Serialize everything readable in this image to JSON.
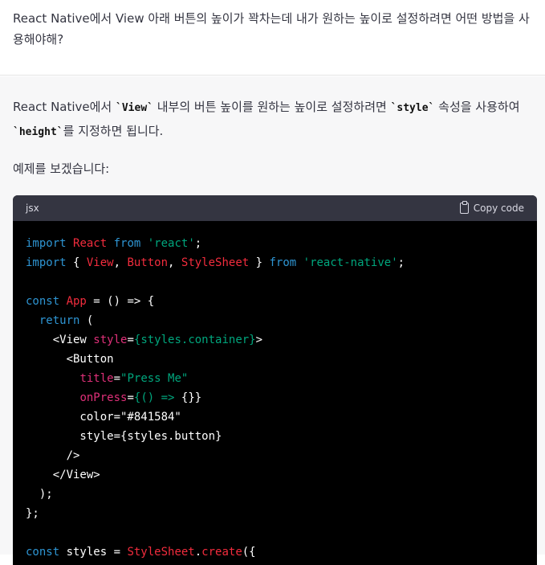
{
  "user_message": {
    "text": "React Native에서 View 아래 버튼의 높이가 꽉차는데 내가 원하는 높이로 설정하려면 어떤 방법을 사용해야해?"
  },
  "assistant_message": {
    "p1_a": "React Native에서 ",
    "p1_code1": "`View`",
    "p1_b": " 내부의 버튼 높이를 원하는 높이로 설정하려면 ",
    "p1_code2": "`style`",
    "p1_c": " 속성을 사용하여 ",
    "p1_code3": "`height`",
    "p1_d": "를 지정하면 됩니다.",
    "p2": "예제를 보겠습니다:"
  },
  "code_block": {
    "language": "jsx",
    "copy_label": "Copy code",
    "lines": [
      [
        [
          "kw",
          "import "
        ],
        [
          "cls",
          "React "
        ],
        [
          "kw",
          "from "
        ],
        [
          "str",
          "'react'"
        ],
        [
          "pl",
          ";"
        ]
      ],
      [
        [
          "kw",
          "import "
        ],
        [
          "pl",
          "{ "
        ],
        [
          "cls",
          "View"
        ],
        [
          "pl",
          ", "
        ],
        [
          "cls",
          "Button"
        ],
        [
          "pl",
          ", "
        ],
        [
          "cls",
          "StyleSheet"
        ],
        [
          "pl",
          " } "
        ],
        [
          "kw",
          "from "
        ],
        [
          "str",
          "'react-native'"
        ],
        [
          "pl",
          ";"
        ]
      ],
      [],
      [
        [
          "kw",
          "const "
        ],
        [
          "cls",
          "App"
        ],
        [
          "pl",
          " = () => {"
        ]
      ],
      [
        [
          "pl",
          "  "
        ],
        [
          "kw",
          "return"
        ],
        [
          "pl",
          " ("
        ]
      ],
      [
        [
          "pl",
          "    <View "
        ],
        [
          "attr",
          "style"
        ],
        [
          "pl",
          "="
        ],
        [
          "str",
          "{styles.container}"
        ],
        [
          "pl",
          ">"
        ]
      ],
      [
        [
          "pl",
          "      <Button"
        ]
      ],
      [
        [
          "pl",
          "        "
        ],
        [
          "attr",
          "title"
        ],
        [
          "pl",
          "="
        ],
        [
          "str",
          "\"Press Me\""
        ]
      ],
      [
        [
          "pl",
          "        "
        ],
        [
          "attr",
          "onPress"
        ],
        [
          "pl",
          "="
        ],
        [
          "str",
          "{() => "
        ],
        [
          "pl",
          "{}}"
        ]
      ],
      [
        [
          "pl",
          "        color=\"#841584\""
        ]
      ],
      [
        [
          "pl",
          "        style={styles.button}"
        ]
      ],
      [
        [
          "pl",
          "      />"
        ]
      ],
      [
        [
          "pl",
          "    </View>"
        ]
      ],
      [
        [
          "pl",
          "  );"
        ]
      ],
      [
        [
          "pl",
          "};"
        ]
      ],
      [],
      [
        [
          "kw",
          "const "
        ],
        [
          "pl",
          "styles = "
        ],
        [
          "cls",
          "StyleSheet"
        ],
        [
          "pl",
          "."
        ],
        [
          "cls",
          "create"
        ],
        [
          "pl",
          "({"
        ]
      ]
    ]
  }
}
